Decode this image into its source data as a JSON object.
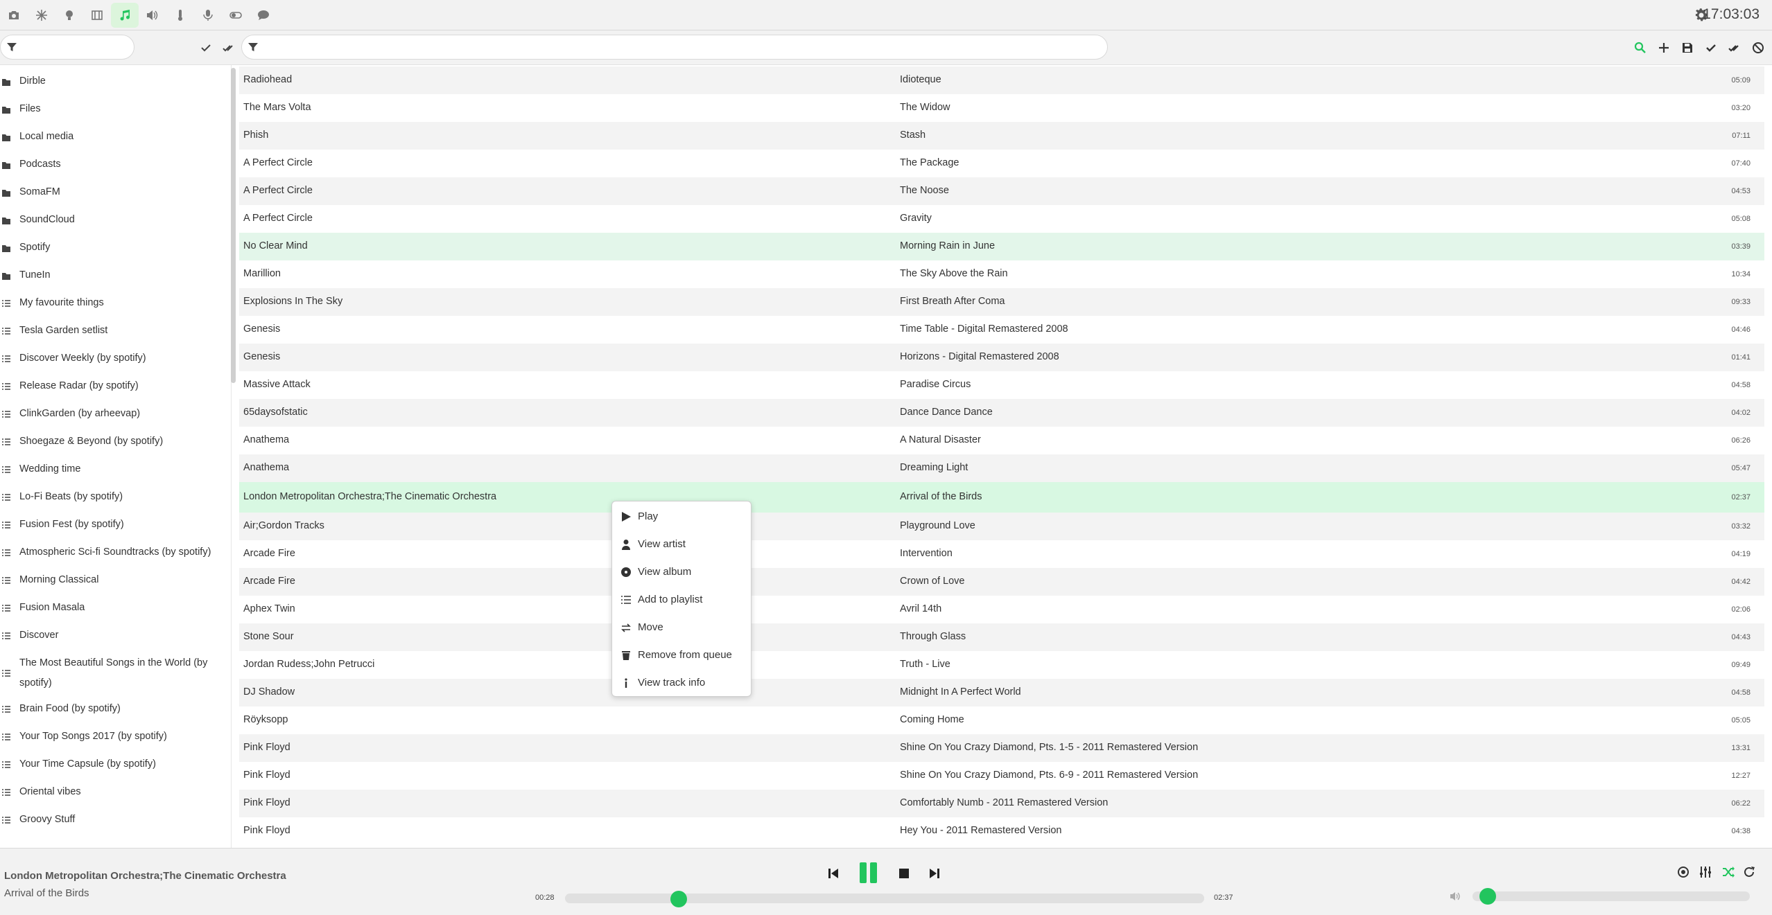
{
  "topbar": {
    "clock": "17:03:03",
    "plugins": [
      {
        "icon": "camera-icon"
      },
      {
        "icon": "snowflake-icon"
      },
      {
        "icon": "lightbulb-icon"
      },
      {
        "icon": "film-icon"
      },
      {
        "icon": "music-icon",
        "active": true
      },
      {
        "icon": "volume-icon"
      },
      {
        "icon": "thermometer-icon"
      },
      {
        "icon": "microphone-icon"
      },
      {
        "icon": "toggle-icon"
      },
      {
        "icon": "chat-icon"
      }
    ]
  },
  "filters": {
    "sidebar_filter": {
      "value": "",
      "placeholder": ""
    },
    "queue_filter": {
      "value": "",
      "placeholder": ""
    }
  },
  "colors": {
    "accent": "#22c55e",
    "current_row": "#d8f8e2",
    "highlight_row": "#e3f6ea",
    "alt_row": "#f3f3f3"
  },
  "sidebar": {
    "items": [
      {
        "type": "folder",
        "label": "Dirble"
      },
      {
        "type": "folder",
        "label": "Files"
      },
      {
        "type": "folder",
        "label": "Local media"
      },
      {
        "type": "folder",
        "label": "Podcasts"
      },
      {
        "type": "folder",
        "label": "SomaFM"
      },
      {
        "type": "folder",
        "label": "SoundCloud"
      },
      {
        "type": "folder",
        "label": "Spotify"
      },
      {
        "type": "folder",
        "label": "TuneIn"
      },
      {
        "type": "playlist",
        "label": "My favourite things"
      },
      {
        "type": "playlist",
        "label": "Tesla Garden setlist"
      },
      {
        "type": "playlist",
        "label": "Discover Weekly (by spotify)"
      },
      {
        "type": "playlist",
        "label": "Release Radar (by spotify)"
      },
      {
        "type": "playlist",
        "label": "ClinkGarden (by arheevap)"
      },
      {
        "type": "playlist",
        "label": "Shoegaze & Beyond (by spotify)"
      },
      {
        "type": "playlist",
        "label": "Wedding time"
      },
      {
        "type": "playlist",
        "label": "Lo-Fi Beats (by spotify)"
      },
      {
        "type": "playlist",
        "label": "Fusion Fest (by spotify)"
      },
      {
        "type": "playlist",
        "label": "Atmospheric Sci-fi Soundtracks (by spotify)"
      },
      {
        "type": "playlist",
        "label": "Morning Classical"
      },
      {
        "type": "playlist",
        "label": "Fusion Masala"
      },
      {
        "type": "playlist",
        "label": "Discover"
      },
      {
        "type": "playlist",
        "label": "The Most Beautiful Songs in the World (by spotify)"
      },
      {
        "type": "playlist",
        "label": "Brain Food (by spotify)"
      },
      {
        "type": "playlist",
        "label": "Your Top Songs 2017 (by spotify)"
      },
      {
        "type": "playlist",
        "label": "Your Time Capsule (by spotify)"
      },
      {
        "type": "playlist",
        "label": "Oriental vibes"
      },
      {
        "type": "playlist",
        "label": "Groovy Stuff"
      }
    ]
  },
  "queue": {
    "tracks": [
      {
        "artist": "Radiohead",
        "title": "Idioteque",
        "duration": "05:09"
      },
      {
        "artist": "The Mars Volta",
        "title": "The Widow",
        "duration": "03:20"
      },
      {
        "artist": "Phish",
        "title": "Stash",
        "duration": "07:11"
      },
      {
        "artist": "A Perfect Circle",
        "title": "The Package",
        "duration": "07:40"
      },
      {
        "artist": "A Perfect Circle",
        "title": "The Noose",
        "duration": "04:53"
      },
      {
        "artist": "A Perfect Circle",
        "title": "Gravity",
        "duration": "05:08"
      },
      {
        "artist": "No Clear Mind",
        "title": "Morning Rain in June",
        "duration": "03:39",
        "state": "highlight"
      },
      {
        "artist": "Marillion",
        "title": "The Sky Above the Rain",
        "duration": "10:34"
      },
      {
        "artist": "Explosions In The Sky",
        "title": "First Breath After Coma",
        "duration": "09:33"
      },
      {
        "artist": "Genesis",
        "title": "Time Table - Digital Remastered 2008",
        "duration": "04:46"
      },
      {
        "artist": "Genesis",
        "title": "Horizons - Digital Remastered 2008",
        "duration": "01:41"
      },
      {
        "artist": "Massive Attack",
        "title": "Paradise Circus",
        "duration": "04:58"
      },
      {
        "artist": "65daysofstatic",
        "title": "Dance Dance Dance",
        "duration": "04:02"
      },
      {
        "artist": "Anathema",
        "title": "A Natural Disaster",
        "duration": "06:26"
      },
      {
        "artist": "Anathema",
        "title": "Dreaming Light",
        "duration": "05:47"
      },
      {
        "artist": "London Metropolitan Orchestra;The Cinematic Orchestra",
        "title": "Arrival of the Birds",
        "duration": "02:37",
        "state": "current"
      },
      {
        "artist": "Air;Gordon Tracks",
        "title": "Playground Love",
        "duration": "03:32"
      },
      {
        "artist": "Arcade Fire",
        "title": "Intervention",
        "duration": "04:19"
      },
      {
        "artist": "Arcade Fire",
        "title": "Crown of Love",
        "duration": "04:42"
      },
      {
        "artist": "Aphex Twin",
        "title": "Avril 14th",
        "duration": "02:06"
      },
      {
        "artist": "Stone Sour",
        "title": "Through Glass",
        "duration": "04:43"
      },
      {
        "artist": "Jordan Rudess;John Petrucci",
        "title": "Truth - Live",
        "duration": "09:49"
      },
      {
        "artist": "DJ Shadow",
        "title": "Midnight In A Perfect World",
        "duration": "04:58"
      },
      {
        "artist": "Röyksopp",
        "title": "Coming Home",
        "duration": "05:05"
      },
      {
        "artist": "Pink Floyd",
        "title": "Shine On You Crazy Diamond, Pts. 1-5 - 2011 Remastered Version",
        "duration": "13:31"
      },
      {
        "artist": "Pink Floyd",
        "title": "Shine On You Crazy Diamond, Pts. 6-9 - 2011 Remastered Version",
        "duration": "12:27"
      },
      {
        "artist": "Pink Floyd",
        "title": "Comfortably Numb - 2011 Remastered Version",
        "duration": "06:22"
      },
      {
        "artist": "Pink Floyd",
        "title": "Hey You - 2011 Remastered Version",
        "duration": "04:38"
      }
    ]
  },
  "context_menu": {
    "items": [
      {
        "label": "Play",
        "icon": "play-icon"
      },
      {
        "label": "View artist",
        "icon": "user-icon"
      },
      {
        "label": "View album",
        "icon": "album-icon"
      },
      {
        "label": "Add to playlist",
        "icon": "list-add-icon"
      },
      {
        "label": "Move",
        "icon": "move-icon"
      },
      {
        "label": "Remove from queue",
        "icon": "trash-icon"
      },
      {
        "label": "View track info",
        "icon": "info-icon"
      }
    ]
  },
  "player": {
    "artist": "London Metropolitan Orchestra;The Cinematic Orchestra",
    "title": "Arrival of the Birds",
    "position": "00:28",
    "duration": "02:37",
    "progress_fraction": 0.178,
    "volume_fraction": 0.055,
    "state": "playing"
  }
}
